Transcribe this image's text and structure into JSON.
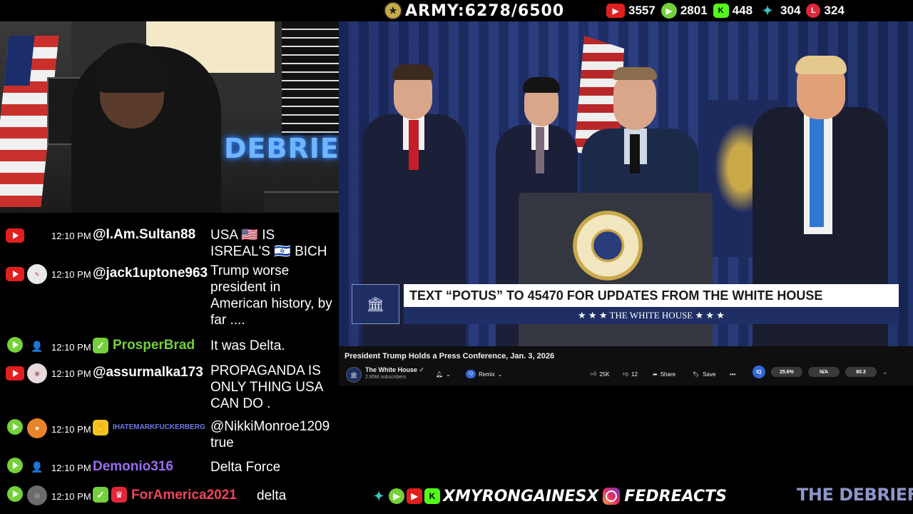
{
  "topbar": {
    "army_label": "ARMY:6278/6500",
    "stats": [
      {
        "platform": "youtube",
        "icon": "youtube-icon",
        "color": "#e21f1f",
        "count": "3557"
      },
      {
        "platform": "rumble",
        "icon": "rumble-icon",
        "color": "#75d13a",
        "count": "2801"
      },
      {
        "platform": "x-kick",
        "icon": "kick-icon",
        "color": "#53fc18",
        "count": "448"
      },
      {
        "platform": "flag",
        "icon": "party-icon",
        "color": "#33c6c6",
        "count": "304"
      },
      {
        "platform": "locals",
        "icon": "locals-icon",
        "color": "#e0283b",
        "count": "324"
      }
    ]
  },
  "webcam": {
    "neon_sign": "DEBRIEF"
  },
  "chat": {
    "messages": [
      {
        "platform": "youtube",
        "time": "12:10 PM",
        "user": "@I.Am.Sultan88",
        "user_color": "#ffffff",
        "text": "USA 🇺🇸 IS ISREAL'S 🇮🇱 BICH"
      },
      {
        "platform": "youtube",
        "time": "12:10 PM",
        "user": "@jack1uptone963",
        "user_color": "#ffffff",
        "text": "Trump worse president in American history, by far ...."
      },
      {
        "platform": "rumble",
        "time": "12:10 PM",
        "user": "ProsperBrad",
        "user_color": "#75d13a",
        "text": "It was Delta."
      },
      {
        "platform": "youtube",
        "time": "12:10 PM",
        "user": "@assurmalka173",
        "user_color": "#ffffff",
        "text": "PROPAGANDA IS ONLY THING USA CAN DO ."
      },
      {
        "platform": "rumble",
        "time": "12:10 PM",
        "user": "IHATEMARKFUCKERBERG",
        "user_color": "#6f79e6",
        "text": "@NikkiMonroe1209 true"
      },
      {
        "platform": "rumble",
        "time": "12:10 PM",
        "user": "Demonio316",
        "user_color": "#9a6cf0",
        "text": "Delta Force"
      },
      {
        "platform": "rumble",
        "time": "12:10 PM",
        "user": "ForAmerica2021",
        "user_color": "#f0455a",
        "text": "delta"
      }
    ]
  },
  "video": {
    "lower_third_main": "TEXT “POTUS” TO 45470 FOR UPDATES FROM THE WHITE HOUSE",
    "lower_third_sub": "★ ★ ★   THE WHITE HOUSE   ★ ★ ★"
  },
  "youtube": {
    "title": "President Trump Holds a Press Conference, Jan. 3, 2026",
    "channel": "The White House",
    "subscribers": "2.85M subscribers",
    "remix_label": "Remix",
    "likes": "25K",
    "dislikes": "12",
    "share_label": "Share",
    "save_label": "Save",
    "ext_iq": "IQ",
    "ext_values": [
      "25.6%",
      "N/A",
      "80.3"
    ]
  },
  "bottombar": {
    "handle1": "XMYRONGAINESX",
    "handle2": "FEDREACTS",
    "brand": "THE DEBRIEF"
  },
  "colors": {
    "youtube_red": "#e21f1f",
    "rumble_green": "#75d13a",
    "video_blue": "#25397e"
  }
}
